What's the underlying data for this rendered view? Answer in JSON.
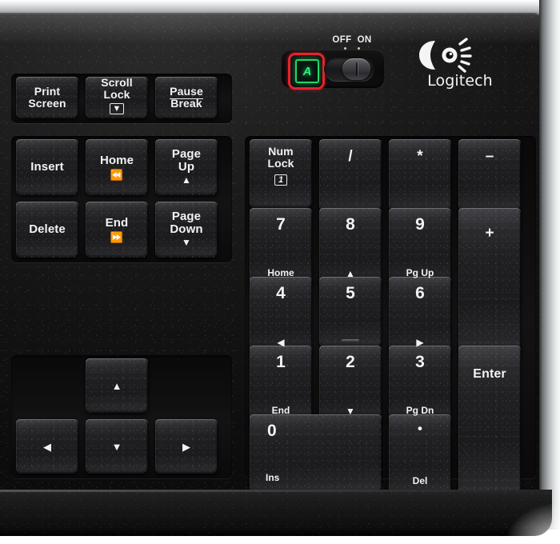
{
  "product": {
    "brand": "Logitech",
    "logo_icon": "logitech-comet-logo"
  },
  "power_switch": {
    "off_label": "OFF",
    "on_label": "ON",
    "state": "ON"
  },
  "indicator": {
    "caps_lock_letter": "A",
    "highlight_color": "#e8232a",
    "led_color": "#2bec7b"
  },
  "colors": {
    "key_face": "#202023",
    "chassis": "#121213",
    "bezel": "#b9bcbe",
    "legend": "#f2f2f2"
  },
  "keys": {
    "function_row": [
      {
        "main": "Print",
        "main2": "Screen",
        "glyph": ""
      },
      {
        "main": "Scroll",
        "main2": "Lock",
        "glyph": "boxed-down-arrow"
      },
      {
        "main": "Pause",
        "main2": "Break",
        "glyph": ""
      }
    ],
    "nav_cluster": [
      {
        "main": "Insert",
        "glyph": ""
      },
      {
        "main": "Home",
        "glyph": "skip-start"
      },
      {
        "main": "Page",
        "main2": "Up",
        "glyph": "up-triangle"
      },
      {
        "main": "Delete",
        "glyph": ""
      },
      {
        "main": "End",
        "glyph": "skip-end"
      },
      {
        "main": "Page",
        "main2": "Down",
        "glyph": "down-triangle"
      }
    ],
    "arrows": [
      {
        "glyph": "up-triangle",
        "name": "arrow-up"
      },
      {
        "glyph": "left-triangle",
        "name": "arrow-left"
      },
      {
        "glyph": "down-triangle",
        "name": "arrow-down"
      },
      {
        "glyph": "right-triangle",
        "name": "arrow-right"
      }
    ],
    "numpad": [
      {
        "main": "Num",
        "main2": "Lock",
        "glyph": "boxed-1"
      },
      {
        "main": "/",
        "glyph": ""
      },
      {
        "main": "*",
        "glyph": ""
      },
      {
        "main": "–",
        "glyph": ""
      },
      {
        "main": "7",
        "sub": "Home"
      },
      {
        "main": "8",
        "sub": "up-triangle"
      },
      {
        "main": "9",
        "sub": "Pg Up"
      },
      {
        "main": "+",
        "glyph": ""
      },
      {
        "main": "4",
        "sub": "left-triangle"
      },
      {
        "main": "5",
        "sub": ""
      },
      {
        "main": "6",
        "sub": "right-triangle"
      },
      {
        "main": "1",
        "sub": "End"
      },
      {
        "main": "2",
        "sub": "down-triangle"
      },
      {
        "main": "3",
        "sub": "Pg Dn"
      },
      {
        "main": "Enter",
        "glyph": ""
      },
      {
        "main": "0",
        "sub": "Ins"
      },
      {
        "main": "•",
        "sub": "Del"
      }
    ]
  }
}
